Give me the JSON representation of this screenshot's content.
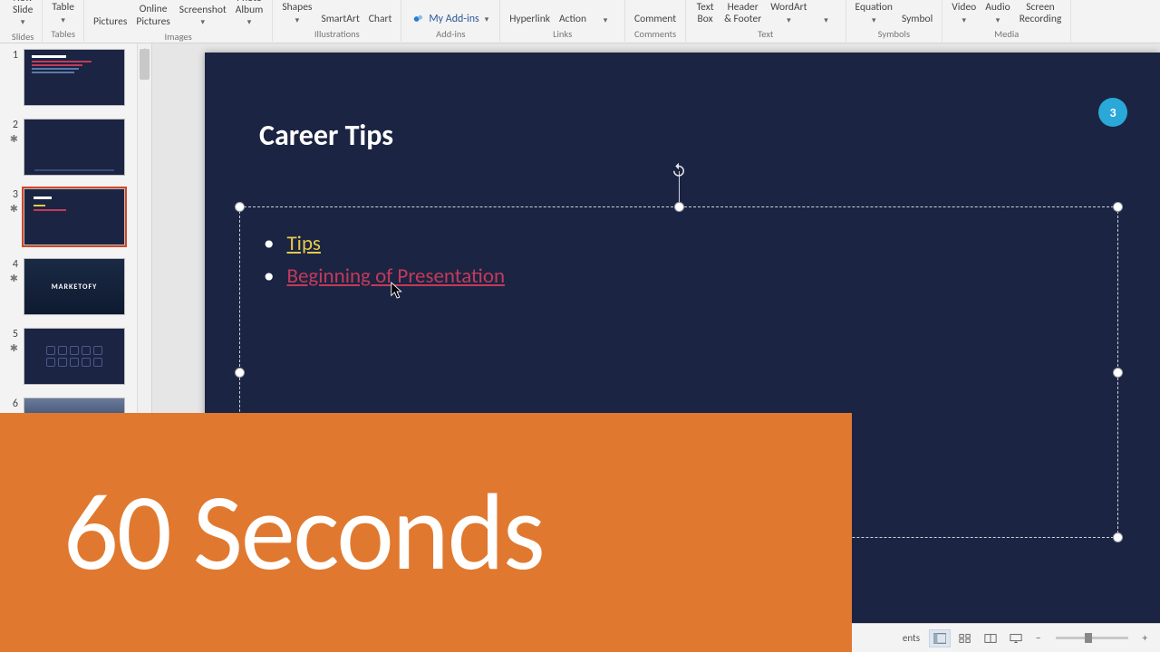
{
  "ribbon": {
    "groups": [
      {
        "label": "Slides",
        "items": [
          {
            "text": "New\nSlide",
            "caret": true
          }
        ]
      },
      {
        "label": "Tables",
        "items": [
          {
            "text": "Table",
            "caret": true
          }
        ]
      },
      {
        "label": "Images",
        "items": [
          {
            "text": "Pictures"
          },
          {
            "text": "Online\nPictures"
          },
          {
            "text": "Screenshot",
            "caret": true
          },
          {
            "text": "Photo\nAlbum",
            "caret": true
          }
        ]
      },
      {
        "label": "Illustrations",
        "items": [
          {
            "text": "Shapes",
            "caret": true
          },
          {
            "text": "SmartArt"
          },
          {
            "text": "Chart"
          }
        ]
      },
      {
        "label": "Add-ins",
        "addins": "My Add-ins",
        "items": [
          {
            "text": "",
            "caret": true
          }
        ]
      },
      {
        "label": "Links",
        "items": [
          {
            "text": "Hyperlink"
          },
          {
            "text": "Action"
          }
        ],
        "extra_caret": true
      },
      {
        "label": "Comments",
        "items": [
          {
            "text": "Comment"
          }
        ]
      },
      {
        "label": "Text",
        "items": [
          {
            "text": "Text\nBox"
          },
          {
            "text": "Header\n& Footer"
          },
          {
            "text": "WordArt",
            "caret": true
          }
        ],
        "extra_caret": true
      },
      {
        "label": "Symbols",
        "items": [
          {
            "text": "Equation",
            "caret": true
          },
          {
            "text": "Symbol"
          }
        ]
      },
      {
        "label": "Media",
        "items": [
          {
            "text": "Video",
            "caret": true
          },
          {
            "text": "Audio",
            "caret": true
          },
          {
            "text": "Screen\nRecording"
          }
        ]
      }
    ]
  },
  "thumbnails": [
    {
      "num": "1",
      "star": false,
      "variant": "content"
    },
    {
      "num": "2",
      "star": true,
      "variant": "empty"
    },
    {
      "num": "3",
      "star": true,
      "variant": "current",
      "selected": true
    },
    {
      "num": "4",
      "star": true,
      "variant": "marketofy",
      "marketofy": "MARKETOFY"
    },
    {
      "num": "5",
      "star": true,
      "variant": "grid"
    },
    {
      "num": "6",
      "star": false,
      "variant": "partial"
    }
  ],
  "slide": {
    "title": "Career Tips",
    "badge": "3",
    "bullets": {
      "b1": "Tips",
      "b2": "Beginning of Presentation"
    }
  },
  "banner": {
    "text": "60 Seconds"
  },
  "status": {
    "ents": "ents",
    "minus": "−",
    "plus": "+"
  }
}
